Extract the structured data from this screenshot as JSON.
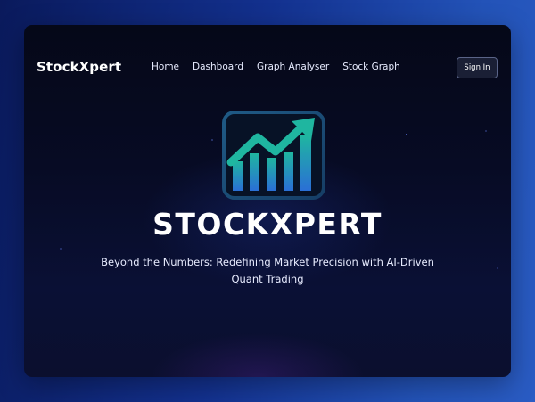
{
  "header": {
    "brand": "StockXpert",
    "nav": [
      {
        "label": "Home"
      },
      {
        "label": "Dashboard"
      },
      {
        "label": "Graph Analyser"
      },
      {
        "label": "Stock Graph"
      }
    ],
    "signin_label": "Sign In"
  },
  "hero": {
    "logo_icon": "rising-chart-icon",
    "title": "STOCKXPERT",
    "subtitle": "Beyond the Numbers: Redefining Market Precision with AI-Driven Quant Trading"
  },
  "colors": {
    "background_left": "#0a1a5c",
    "background_right": "#2a5cc4",
    "window": "#070b24",
    "logo_teal": "#1fb6a0",
    "logo_blue": "#2a6fd6",
    "logo_border": "#1e4f7a"
  }
}
